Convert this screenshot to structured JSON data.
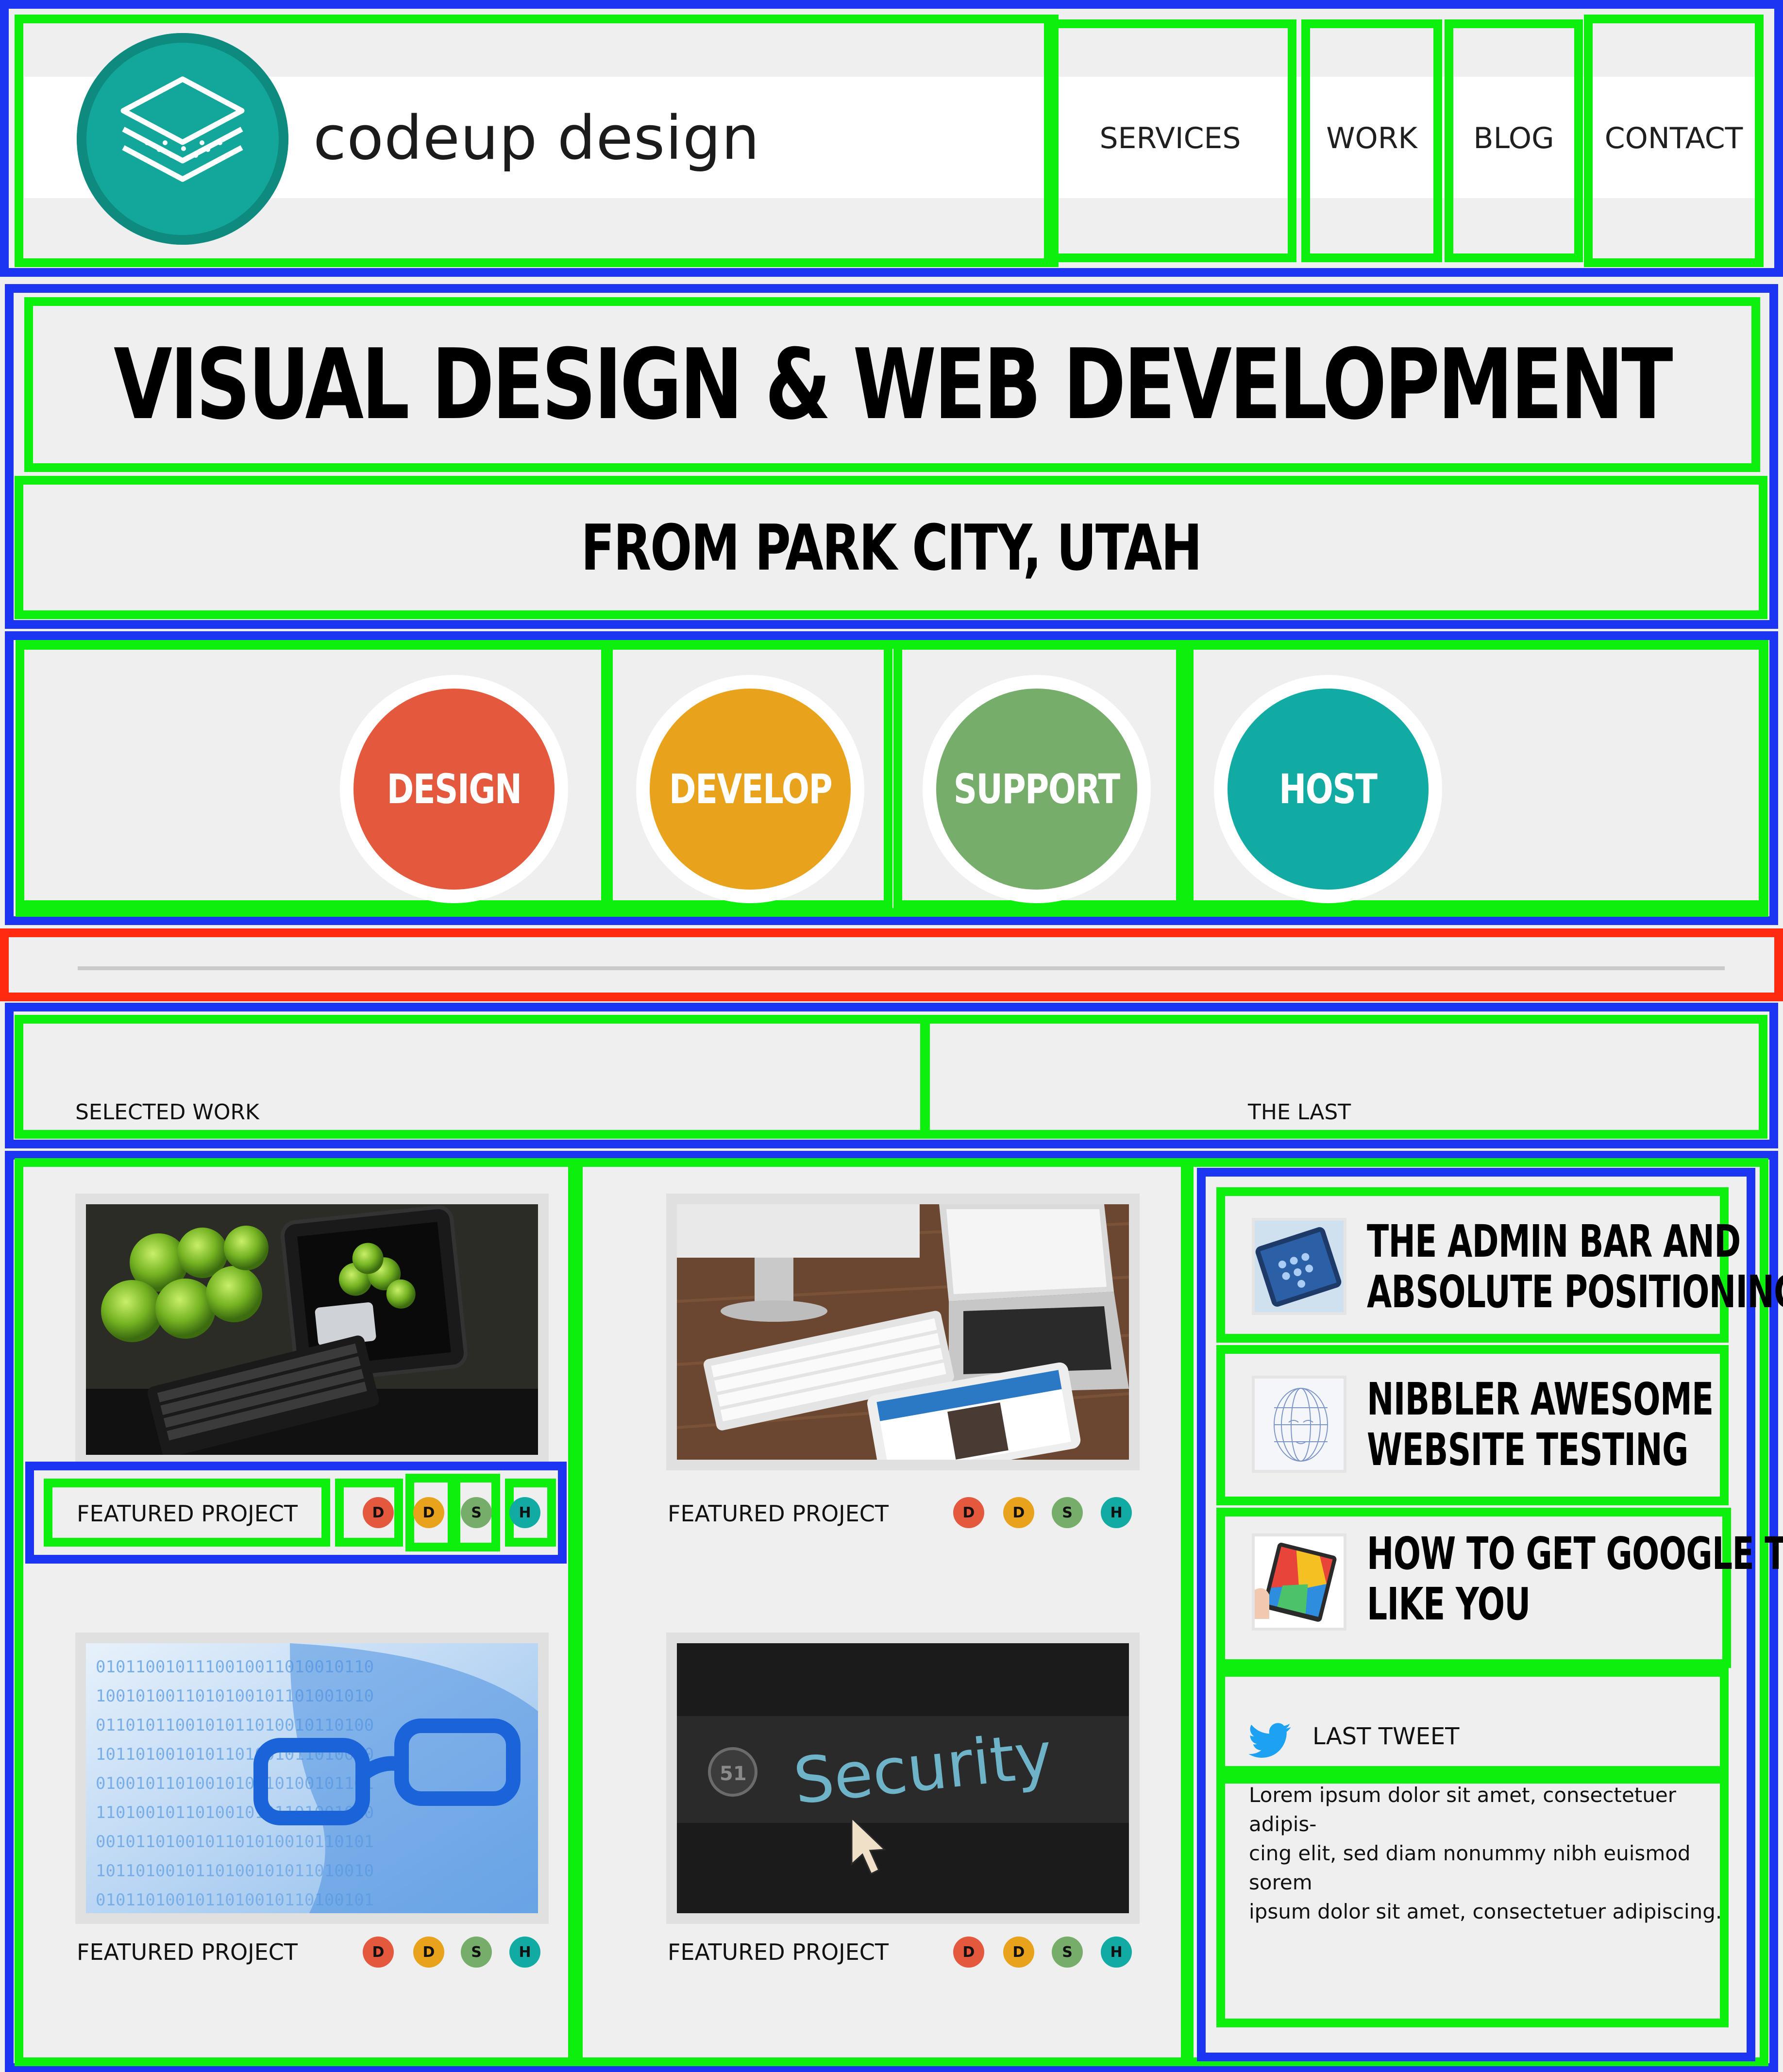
{
  "brand": {
    "name": "codeup design"
  },
  "nav": {
    "items": [
      "SERVICES",
      "WORK",
      "BLOG",
      "CONTACT"
    ]
  },
  "hero": {
    "title": "VISUAL DESIGN & WEB DEVELOPMENT",
    "subtitle": "FROM PARK CITY, UTAH"
  },
  "services": [
    {
      "label": "DESIGN",
      "color": "#e4593d"
    },
    {
      "label": "DEVELOP",
      "color": "#e8a21c"
    },
    {
      "label": "SUPPORT",
      "color": "#77ad6a"
    },
    {
      "label": "HOST",
      "color": "#12aba4"
    }
  ],
  "sections": {
    "selected_work": "SELECTED WORK",
    "the_last": "THE LAST"
  },
  "projects": [
    {
      "label": "FEATURED PROJECT",
      "image": "tablet-apples-photo"
    },
    {
      "label": "FEATURED PROJECT",
      "image": "desk-computers-photo"
    },
    {
      "label": "FEATURED PROJECT",
      "image": "binary-face-glasses-photo"
    },
    {
      "label": "FEATURED PROJECT",
      "image": "security-screen-photo"
    }
  ],
  "dots": [
    {
      "letter": "D",
      "color": "#e4593d"
    },
    {
      "letter": "D",
      "color": "#e8a21c"
    },
    {
      "letter": "S",
      "color": "#77ad6a"
    },
    {
      "letter": "H",
      "color": "#12aba4"
    }
  ],
  "posts": [
    {
      "line1": "THE ADMIN BAR AND",
      "line2": "ABSOLUTE POSITIONING",
      "thumb": "social-tablet-thumb"
    },
    {
      "line1": "NIBBLER AWESOME",
      "line2": "WEBSITE TESTING",
      "thumb": "wireframe-face-thumb"
    },
    {
      "line1": "HOW TO GET GOOGLE TO",
      "line2": "LIKE YOU",
      "thumb": "colorful-tablet-thumb"
    }
  ],
  "tweet": {
    "heading": "LAST TWEET",
    "icon": "twitter-bird-icon",
    "lines": [
      "Lorem ipsum dolor sit amet, consectetuer adipis-",
      "cing elit, sed diam nonummy nibh euismod sorem",
      "ipsum dolor sit amet, consectetuer adipiscing."
    ]
  }
}
